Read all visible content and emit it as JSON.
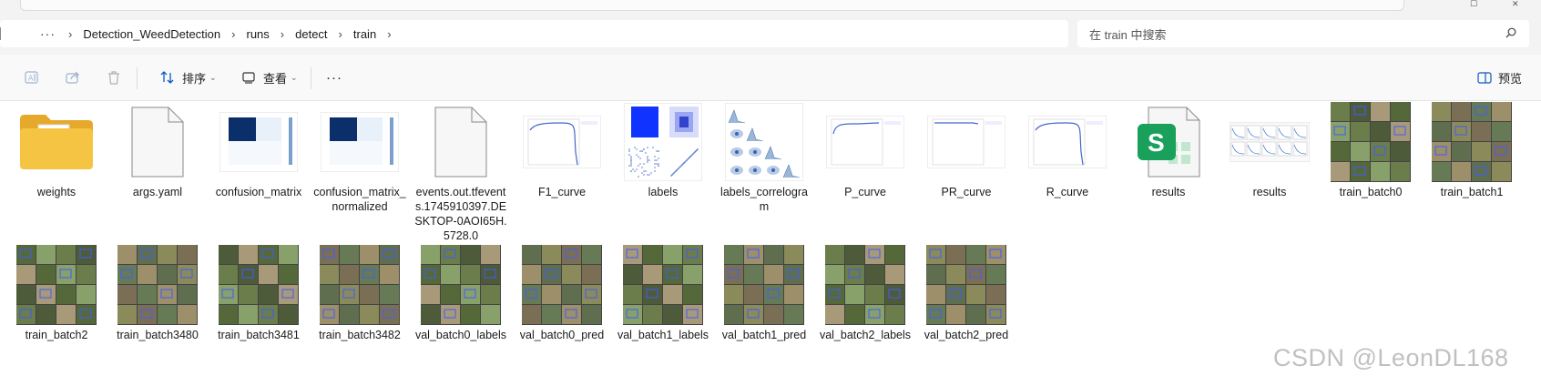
{
  "window": {
    "minimize_glyph": "—",
    "maximize_glyph": "☐",
    "close_glyph": "✕"
  },
  "breadcrumb": {
    "more": "···",
    "items": [
      "Detection_WeedDetection",
      "runs",
      "detect",
      "train"
    ],
    "sep": "›"
  },
  "search": {
    "placeholder": "在 train 中搜索"
  },
  "toolbar": {
    "sort_label": "排序",
    "view_label": "查看",
    "more_label": "···",
    "preview_label": "预览"
  },
  "files": [
    {
      "name": "weights",
      "kind": "folder"
    },
    {
      "name": "args.yaml",
      "kind": "doc"
    },
    {
      "name": "confusion_matrix",
      "kind": "confusion"
    },
    {
      "name": "confusion_matrix_normalized",
      "kind": "confusion"
    },
    {
      "name": "events.out.tfevents.1745910397.DESKTOP-0AOI65H.5728.0",
      "kind": "doc"
    },
    {
      "name": "F1_curve",
      "kind": "curve"
    },
    {
      "name": "labels",
      "kind": "labels"
    },
    {
      "name": "labels_correlogram",
      "kind": "correlogram"
    },
    {
      "name": "P_curve",
      "kind": "curve"
    },
    {
      "name": "PR_curve",
      "kind": "curve"
    },
    {
      "name": "R_curve",
      "kind": "curve"
    },
    {
      "name": "results",
      "kind": "spreadsheet"
    },
    {
      "name": "results",
      "kind": "results"
    },
    {
      "name": "train_batch0",
      "kind": "photo"
    },
    {
      "name": "train_batch1",
      "kind": "photo"
    },
    {
      "name": "train_batch2",
      "kind": "photo"
    },
    {
      "name": "train_batch3480",
      "kind": "photo"
    },
    {
      "name": "train_batch3481",
      "kind": "photo"
    },
    {
      "name": "train_batch3482",
      "kind": "photo"
    },
    {
      "name": "val_batch0_labels",
      "kind": "photo"
    },
    {
      "name": "val_batch0_pred",
      "kind": "photo"
    },
    {
      "name": "val_batch1_labels",
      "kind": "photo"
    },
    {
      "name": "val_batch1_pred",
      "kind": "photo"
    },
    {
      "name": "val_batch2_labels",
      "kind": "photo"
    },
    {
      "name": "val_batch2_pred",
      "kind": "photo"
    }
  ],
  "watermark": "CSDN @LeonDL168",
  "colors": {
    "accent": "#0a3a82",
    "folder": "#f6c443",
    "spreadsheet": "#19a05a"
  }
}
